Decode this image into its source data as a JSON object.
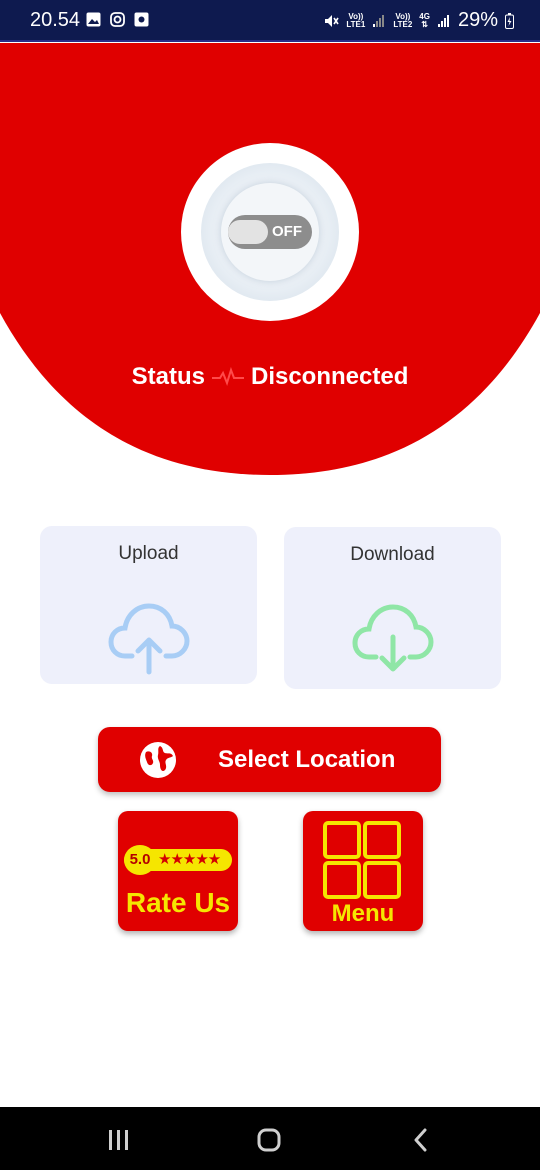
{
  "status_bar": {
    "time": "20.54",
    "sim1": {
      "top": "Vo))",
      "bottom": "LTE1"
    },
    "sim2": {
      "top": "Vo))",
      "bottom": "LTE2"
    },
    "network": "4G",
    "battery": "29%",
    "icons": [
      "gallery-icon",
      "instagram-icon",
      "vpn-key-icon",
      "mute-icon",
      "signal-icon",
      "battery-charging-icon"
    ]
  },
  "colors": {
    "primary_red": "#e00000",
    "accent_yellow": "#f5e600",
    "card_bg": "#eef0fb",
    "upload_blue": "#a8cdf5",
    "download_green": "#8fe6a6"
  },
  "power": {
    "toggle_label": "OFF",
    "state": "off"
  },
  "status": {
    "label": "Status",
    "value": "Disconnected"
  },
  "speed": {
    "upload_label": "Upload",
    "download_label": "Download"
  },
  "actions": {
    "select_location": "Select Location",
    "rating_value": "5.0",
    "rating_stars": "★★★★★",
    "rate_us": "Rate Us",
    "menu": "Menu"
  }
}
